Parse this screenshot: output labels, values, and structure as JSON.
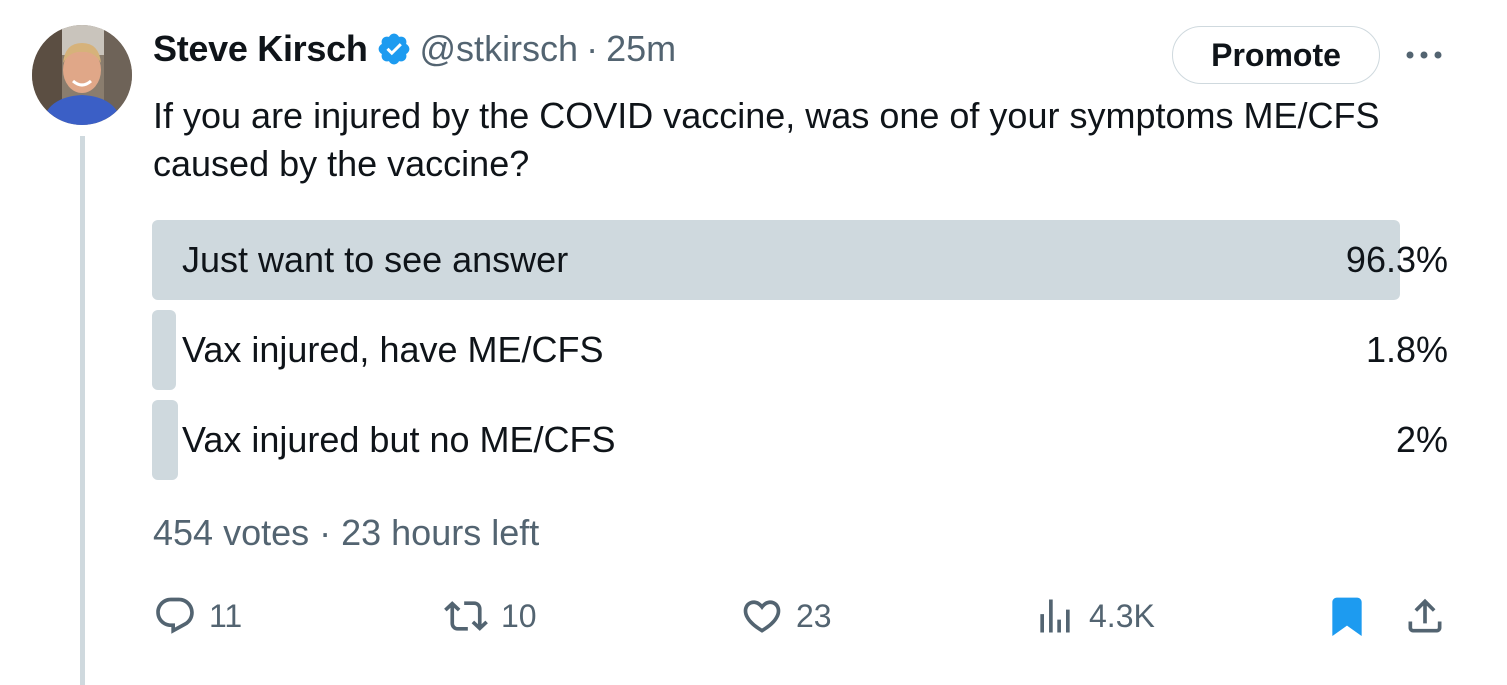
{
  "author": {
    "display_name": "Steve Kirsch",
    "handle": "@stkirsch",
    "separator": "·",
    "time": "25m",
    "verified_icon": "verified-badge-icon"
  },
  "header": {
    "promote_label": "Promote",
    "more_icon": "more-dots-icon"
  },
  "tweet": {
    "text": "If you are injured by the COVID vaccine, was one of your symptoms ME/CFS caused by the vaccine?"
  },
  "poll": {
    "options": [
      {
        "label": "Just want to see answer",
        "percent_text": "96.3%",
        "percent": 96.3
      },
      {
        "label": "Vax injured, have ME/CFS",
        "percent_text": "1.8%",
        "percent": 1.8
      },
      {
        "label": "Vax injured but no ME/CFS",
        "percent_text": "2%",
        "percent": 2
      }
    ],
    "meta": "454 votes · 23 hours left"
  },
  "actions": {
    "reply": {
      "icon": "reply-icon",
      "count": "11"
    },
    "retweet": {
      "icon": "retweet-icon",
      "count": "10"
    },
    "like": {
      "icon": "heart-icon",
      "count": "23"
    },
    "views": {
      "icon": "views-chart-icon",
      "count": "4.3K"
    },
    "bookmark": {
      "icon": "bookmark-icon"
    },
    "share": {
      "icon": "share-icon"
    }
  },
  "colors": {
    "text": "#0f1419",
    "secondary": "#536471",
    "poll_bar": "#cfd9de",
    "verified": "#1d9bf0",
    "bookmark": "#1d9bf0"
  }
}
